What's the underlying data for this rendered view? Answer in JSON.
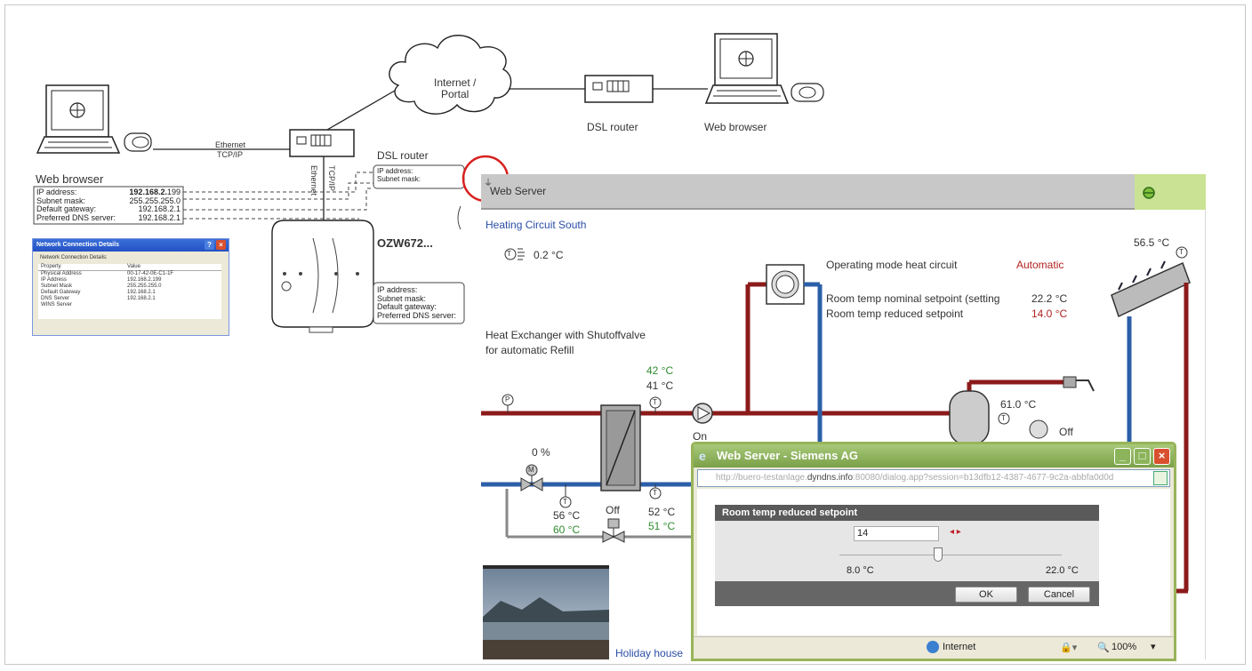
{
  "network": {
    "internet_line1": "Internet /",
    "internet_line2": "Portal",
    "dsl_router_top": "DSL router",
    "web_browser_top": "Web browser",
    "ethernet_h_line1": "Ethernet",
    "ethernet_h_line2": "TCP/IP",
    "ethernet_v_line1": "Ethernet",
    "ethernet_v_line2": "TCP/IP",
    "dsl_router_left": "DSL router",
    "web_browser_left": "Web browser",
    "device_name": "OZW672...",
    "router_ip_labels": [
      "IP address:",
      "Subnet mask:"
    ],
    "device_ip_labels": [
      "IP address:",
      "Subnet mask:",
      "Default gateway:",
      "Preferred DNS server:"
    ],
    "browser_config": [
      {
        "label": "IP address:",
        "value_bold": "192.168.2.",
        "value": "199"
      },
      {
        "label": "Subnet mask:",
        "value_bold": "",
        "value": "255.255.255.0"
      },
      {
        "label": "Default gateway:",
        "value_bold": "",
        "value": "192.168.2.1"
      },
      {
        "label": "Preferred DNS server:",
        "value_bold": "",
        "value": "192.168.2.1"
      }
    ]
  },
  "ncd_window": {
    "title": "Network Connection Details",
    "subtitle": "Network Connection Details:",
    "col_property": "Property",
    "col_value": "Value",
    "rows": [
      {
        "p": "Physical Address",
        "v": "00-17-42-0E-C1-1F"
      },
      {
        "p": "IP Address",
        "v": "192.168.2.199"
      },
      {
        "p": "Subnet Mask",
        "v": "255.255.255.0"
      },
      {
        "p": "Default Gateway",
        "v": "192.168.2.1"
      },
      {
        "p": "DNS Server",
        "v": "192.168.2.1"
      },
      {
        "p": "WINS Server",
        "v": ""
      }
    ]
  },
  "webserver": {
    "title": "Web Server",
    "circuit": "Heating Circuit South",
    "outdoor_temp": "0.2 °C",
    "op_mode_label": "Operating mode heat circuit",
    "op_mode_value": "Automatic",
    "nominal_label": "Room temp nominal setpoint (setting",
    "nominal_value": "22.2 °C",
    "reduced_label": "Room temp reduced setpoint",
    "reduced_value": "14.0 °C",
    "hx_line1": "Heat Exchanger with Shutoffvalve",
    "hx_line2": "for automatic Refill",
    "t_42": "42 °C",
    "t_41": "41 °C",
    "pump_on": "On",
    "valve_pct": "0 %",
    "t_56": "56 °C",
    "t_60": "60 °C",
    "valve_off": "Off",
    "t_52": "52 °C",
    "t_51": "51 °C",
    "collector_temp": "56.5 °C",
    "tank_temp": "61.0 °C",
    "tank_pump_off": "Off",
    "photo_caption": "Holiday house",
    "sensor_T": "T",
    "sensor_P": "P",
    "valve_M": "M"
  },
  "dialog": {
    "title": "Web Server - Siemens AG",
    "url_prefix": "http://buero-testanlage.",
    "url_bold": "dyndns.info",
    "url_suffix": ":80080/dialog.app?session=b13dfb12-4387-4677-9c2a-abbfa0d0d",
    "form_title": "Room temp reduced setpoint",
    "value": "14",
    "min": "8.0 °C",
    "max": "22.0 °C",
    "ok": "OK",
    "cancel": "Cancel",
    "zone": "Internet",
    "zoom": "100%"
  },
  "colors": {
    "hot_pipe": "#8b1a1a",
    "cold_pipe": "#2b5fa8",
    "return_pipe": "#888888",
    "green_value": "#2e8b2e",
    "red_value": "#b22222",
    "blue_text": "#2b4ea8"
  }
}
